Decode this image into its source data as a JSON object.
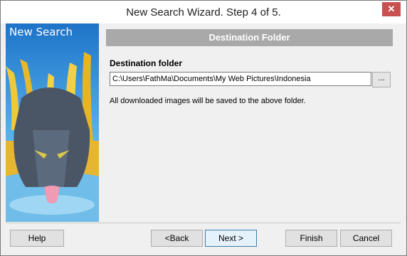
{
  "window": {
    "title": "New Search Wizard. Step 4 of 5.",
    "close_glyph": "✕"
  },
  "side_panel": {
    "title": "New Search"
  },
  "section": {
    "header": "Destination Folder"
  },
  "destination": {
    "label": "Destination folder",
    "path": "C:\\Users\\FathMa\\Documents\\My Web Pictures\\Indonesia",
    "browse_label": "...",
    "note": "All downloaded images will be saved to the above folder."
  },
  "buttons": {
    "help": "Help",
    "back": "<Back",
    "next": "Next >",
    "finish": "Finish",
    "cancel": "Cancel"
  },
  "colors": {
    "close_button": "#c75050",
    "header_bar": "#a9a9a9",
    "side_sky": "#1e73c8",
    "grass": "#e8c22c",
    "panther": "#4a5566"
  },
  "icons": {
    "close": "close-icon"
  }
}
